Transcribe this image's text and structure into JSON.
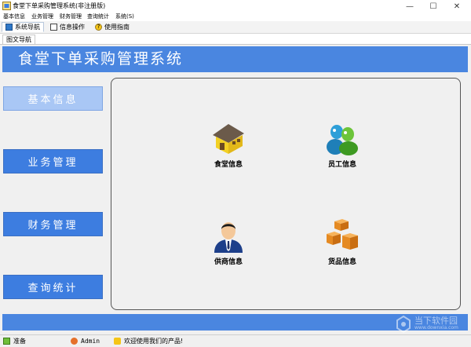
{
  "window": {
    "title": "食堂下单采购管理系统(非注册版)",
    "controls": {
      "minimize": "—",
      "maximize": "☐",
      "close": "✕"
    }
  },
  "menubar": {
    "items": [
      {
        "label": "基本信息"
      },
      {
        "label": "业务管理"
      },
      {
        "label": "财务管理"
      },
      {
        "label": "查询统计"
      },
      {
        "label": "系统(S)"
      }
    ]
  },
  "toolbar": {
    "tabs": [
      {
        "label": "系统导航",
        "icon": "navigation-icon",
        "active": true
      },
      {
        "label": "信息操作",
        "icon": "form-icon",
        "active": false
      },
      {
        "label": "使用指南",
        "icon": "help-icon",
        "active": false
      }
    ]
  },
  "subtab": {
    "label": "图文导航"
  },
  "banner": {
    "title": "食堂下单采购管理系统"
  },
  "nav": {
    "buttons": [
      {
        "label": "基本信息",
        "selected": true
      },
      {
        "label": "业务管理",
        "selected": false
      },
      {
        "label": "财务管理",
        "selected": false
      },
      {
        "label": "查询统计",
        "selected": false
      }
    ]
  },
  "modules": [
    {
      "label": "食堂信息",
      "icon": "canteen-building-icon"
    },
    {
      "label": "员工信息",
      "icon": "staff-people-icon"
    },
    {
      "label": "供商信息",
      "icon": "supplier-person-icon"
    },
    {
      "label": "货品信息",
      "icon": "goods-boxes-icon"
    }
  ],
  "statusbar": {
    "ready": "准备",
    "user": "Admin",
    "message": "欢迎使用我们的产品!"
  },
  "watermark": {
    "text": "当下软件园",
    "url": "www.downxia.com"
  },
  "colors": {
    "accent": "#4a86e0",
    "nav_selected": "#a9c7f5",
    "panel_bg": "#f0f0f0"
  }
}
